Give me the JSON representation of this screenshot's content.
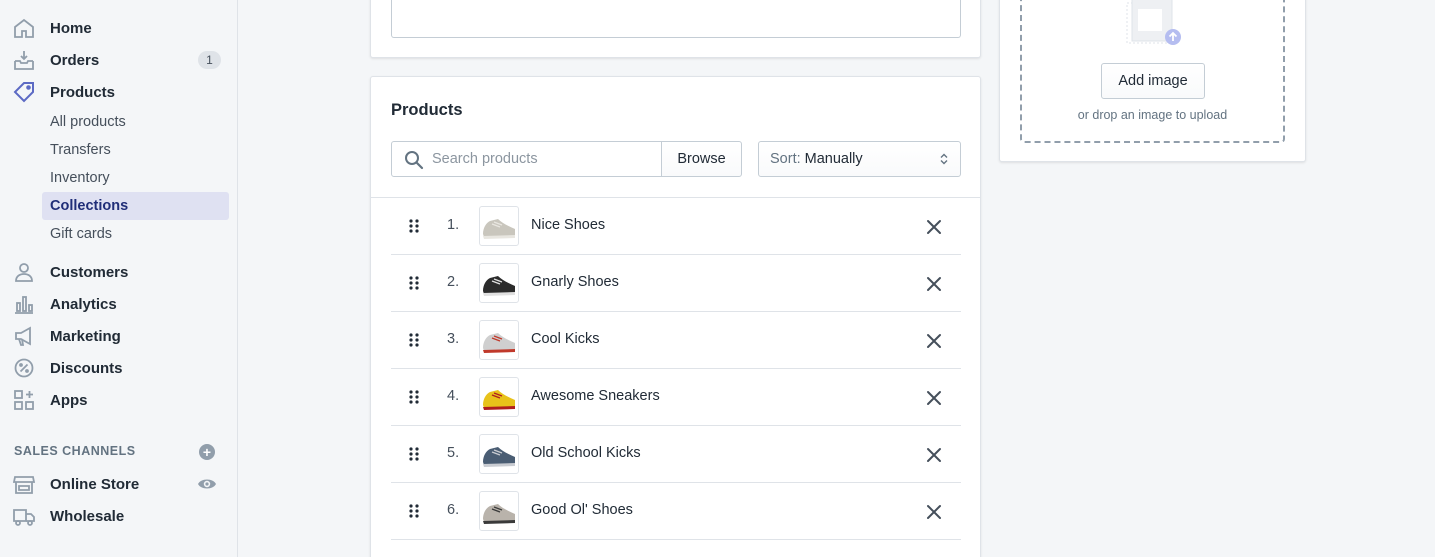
{
  "sidebar": {
    "nav": [
      {
        "label": "Home",
        "icon": "home-icon"
      },
      {
        "label": "Orders",
        "icon": "orders-icon",
        "badge": "1"
      },
      {
        "label": "Products",
        "icon": "tag-icon"
      }
    ],
    "product_sub": [
      {
        "label": "All products"
      },
      {
        "label": "Transfers"
      },
      {
        "label": "Inventory"
      },
      {
        "label": "Collections",
        "active": true
      },
      {
        "label": "Gift cards"
      }
    ],
    "nav2": [
      {
        "label": "Customers",
        "icon": "customer-icon"
      },
      {
        "label": "Analytics",
        "icon": "analytics-icon"
      },
      {
        "label": "Marketing",
        "icon": "megaphone-icon"
      },
      {
        "label": "Discounts",
        "icon": "discount-icon"
      },
      {
        "label": "Apps",
        "icon": "apps-icon"
      }
    ],
    "channels_heading": "SALES CHANNELS",
    "channels": [
      {
        "label": "Online Store",
        "icon": "store-icon"
      },
      {
        "label": "Wholesale",
        "icon": "truck-icon"
      }
    ],
    "active_color": "#202e78",
    "active_bg": "#dfe1f2"
  },
  "products_card": {
    "title": "Products",
    "search_placeholder": "Search products",
    "browse_label": "Browse",
    "sort_prefix": "Sort:",
    "sort_value": "Manually",
    "rows": [
      {
        "index": "1.",
        "name": "Nice Shoes",
        "shoe_color": "#c9c6bd",
        "accent": "#e8e6e0"
      },
      {
        "index": "2.",
        "name": "Gnarly Shoes",
        "shoe_color": "#2b2b2b",
        "accent": "#e0e0e0"
      },
      {
        "index": "3.",
        "name": "Cool Kicks",
        "shoe_color": "#cfcfcf",
        "accent": "#c0392b"
      },
      {
        "index": "4.",
        "name": "Awesome Sneakers",
        "shoe_color": "#e8c21a",
        "accent": "#b01e1e"
      },
      {
        "index": "5.",
        "name": "Old School Kicks",
        "shoe_color": "#4a5d73",
        "accent": "#c9ccd2"
      },
      {
        "index": "6.",
        "name": "Good Ol' Shoes",
        "shoe_color": "#b9b3ab",
        "accent": "#3a3a3a"
      }
    ]
  },
  "image_card": {
    "add_image_label": "Add image",
    "drop_hint": "or drop an image to upload"
  }
}
